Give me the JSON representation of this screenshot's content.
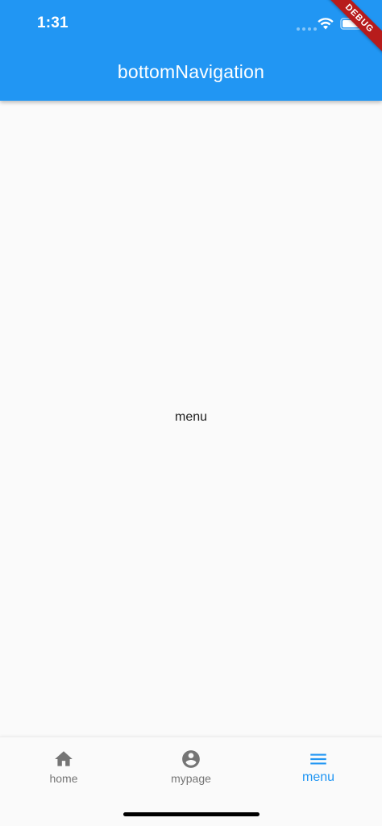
{
  "status_bar": {
    "time": "1:31"
  },
  "app_bar": {
    "title": "bottomNavigation"
  },
  "debug_banner": {
    "label": "DEBUG"
  },
  "content": {
    "text": "menu"
  },
  "bottom_nav": {
    "items": [
      {
        "label": "home",
        "icon": "home-icon",
        "selected": false
      },
      {
        "label": "mypage",
        "icon": "account-circle-icon",
        "selected": false
      },
      {
        "label": "menu",
        "icon": "menu-icon",
        "selected": true
      }
    ]
  },
  "colors": {
    "primary": "#2196f3",
    "inactive": "#757575",
    "background": "#fafafa",
    "debug_ribbon": "#b71c1c"
  }
}
